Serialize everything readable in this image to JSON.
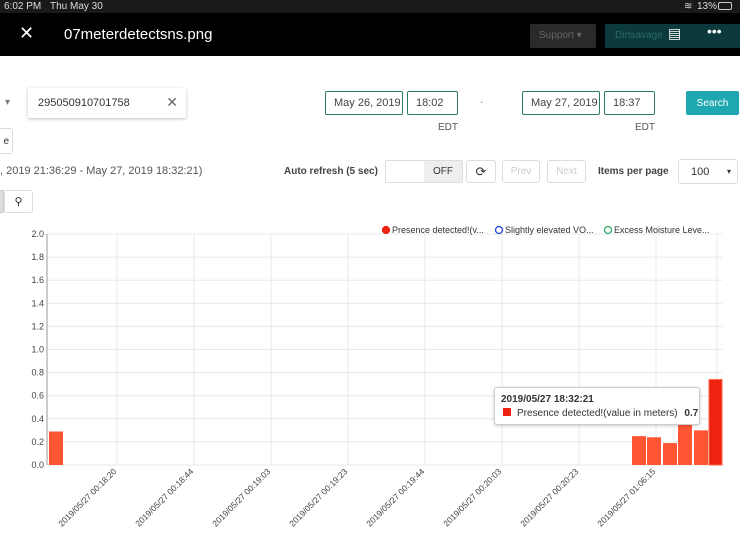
{
  "status_bar": {
    "time": "6:02 PM",
    "date": "Thu May 30",
    "battery": "13%"
  },
  "viewer": {
    "title": "07meterdetectsns.png",
    "support_label": "Support",
    "account_label": "Dirtsavage"
  },
  "filters": {
    "device_id": "295050910701758",
    "start_date": "May 26, 2019",
    "start_time": "18:02",
    "separator": "-",
    "end_date": "May 27, 2019",
    "end_time": "18:37",
    "tz": "EDT",
    "search_label": "Search",
    "partial_button": "e"
  },
  "range_text": ", 2019 21:36:29 - May 27, 2019 18:32:21)",
  "controls": {
    "auto_refresh_label": "Auto refresh (5 sec)",
    "toggle_state": "OFF",
    "prev_label": "Prev",
    "next_label": "Next",
    "items_label": "Items per page",
    "items_value": "100"
  },
  "chart_data": {
    "type": "bar",
    "ylim": [
      0,
      2.0
    ],
    "yticks": [
      "0.0",
      "0.2",
      "0.4",
      "0.6",
      "0.8",
      "1.0",
      "1.2",
      "1.4",
      "1.6",
      "1.8",
      "2.0"
    ],
    "xticks": [
      "2019/05/27 00:18:20",
      "2019/05/27 00:18:44",
      "2019/05/27 00:19:03",
      "2019/05/27 00:19:23",
      "2019/05/27 00:19:44",
      "2019/05/27 00:20:03",
      "2019/05/27 00:20:23",
      "2019/05/27 01:06:15"
    ],
    "grid": true,
    "legend": {
      "placement": "top-right",
      "items": [
        {
          "label": "Presence detected!(v...",
          "color": "#ee2211",
          "filled": true
        },
        {
          "label": "Slightly elevated VO...",
          "color": "#2244dd",
          "filled": false
        },
        {
          "label": "Excess Moisture Leve...",
          "color": "#33aa66",
          "filled": false
        }
      ]
    },
    "series": [
      {
        "name": "Presence detected!(value in meters)",
        "color": "#ff5533",
        "values": [
          0.29,
          0.25,
          0.24,
          0.19,
          0.46,
          0.3,
          0.74
        ]
      }
    ],
    "tooltip": {
      "time": "2019/05/27 18:32:21",
      "label": "Presence detected!(value in meters)",
      "value": "0.7"
    }
  }
}
